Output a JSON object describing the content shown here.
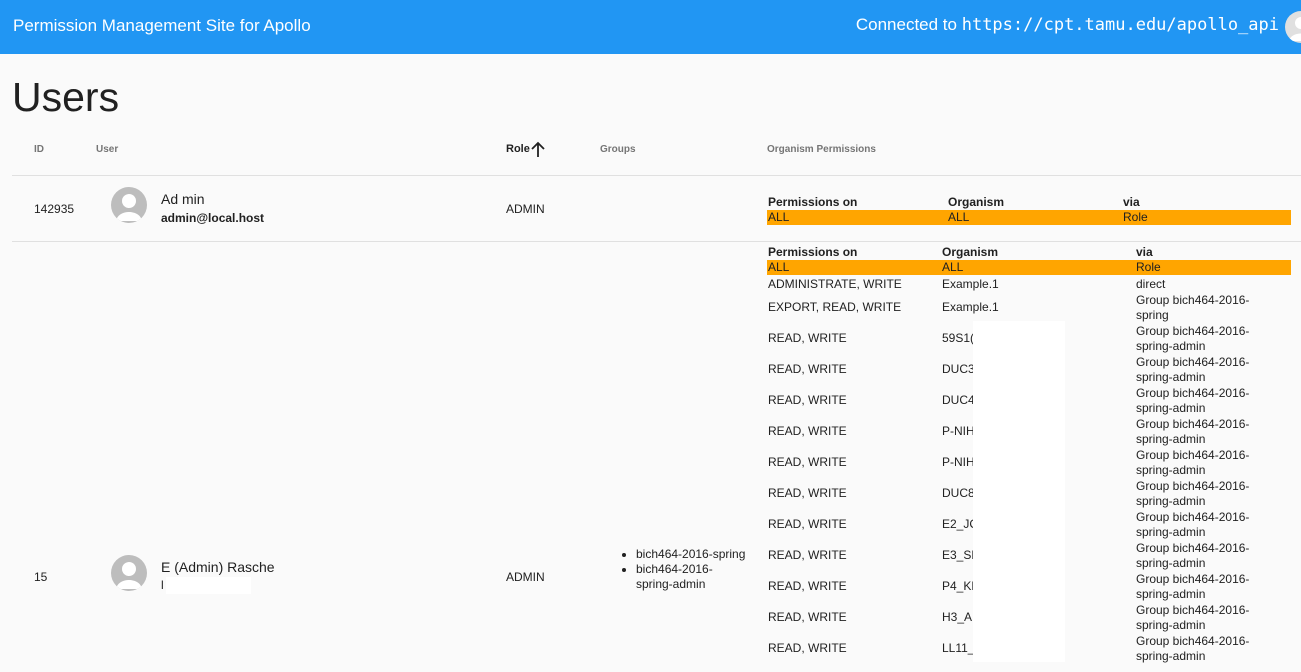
{
  "header": {
    "title": "Permission Management Site for Apollo",
    "connected_prefix": "Connected to",
    "connected_url": "https://cpt.tamu.edu/apollo_api",
    "bg_color": "#2196f3"
  },
  "page": {
    "title": "Users"
  },
  "columns": {
    "id": "ID",
    "user": "User",
    "role": "Role",
    "groups": "Groups",
    "organism_permissions": "Organism Permissions"
  },
  "perm_headers": {
    "permissions_on": "Permissions on",
    "organism": "Organism",
    "via": "via"
  },
  "highlight_color": "#ffa500",
  "users": [
    {
      "id": "142935",
      "name": "Ad min",
      "email": "admin@local.host",
      "role": "ADMIN",
      "groups": [],
      "highlight_row": {
        "permissions": "ALL",
        "organism": "ALL",
        "via": "Role"
      },
      "permissions": []
    },
    {
      "id": "15",
      "name": "E (Admin) Rasche",
      "email": "l",
      "role": "ADMIN",
      "groups": [
        "bich464-2016-spring",
        "bich464-2016-spring-admin"
      ],
      "highlight_row": {
        "permissions": "ALL",
        "organism": "ALL",
        "via": "Role"
      },
      "permissions": [
        {
          "permissions": "ADMINISTRATE, WRITE",
          "organism": "Example.1",
          "via": "direct"
        },
        {
          "permissions": "EXPORT, READ, WRITE",
          "organism": "Example.1",
          "via": "Group bich464-2016-spring"
        },
        {
          "permissions": "READ, WRITE",
          "organism": "59S1(",
          "via": "Group bich464-2016-spring-admin"
        },
        {
          "permissions": "READ, WRITE",
          "organism": "DUC3",
          "via": "Group bich464-2016-spring-admin"
        },
        {
          "permissions": "READ, WRITE",
          "organism": "DUC4",
          "via": "Group bich464-2016-spring-admin"
        },
        {
          "permissions": "READ, WRITE",
          "organism": "P-NIH",
          "via": "Group bich464-2016-spring-admin"
        },
        {
          "permissions": "READ, WRITE",
          "organism": "P-NIH",
          "via": "Group bich464-2016-spring-admin"
        },
        {
          "permissions": "READ, WRITE",
          "organism": "DUC8",
          "via": "Group bich464-2016-spring-admin"
        },
        {
          "permissions": "READ, WRITE",
          "organism": "E2_JC",
          "via": "Group bich464-2016-spring-admin"
        },
        {
          "permissions": "READ, WRITE",
          "organism": "E3_SH",
          "via": "Group bich464-2016-spring-admin"
        },
        {
          "permissions": "READ, WRITE",
          "organism": "P4_KE",
          "via": "Group bich464-2016-spring-admin"
        },
        {
          "permissions": "READ, WRITE",
          "organism": "H3_AI",
          "via": "Group bich464-2016-spring-admin"
        },
        {
          "permissions": "READ, WRITE",
          "organism": "LL11_",
          "via": "Group bich464-2016-spring-admin"
        }
      ]
    }
  ]
}
